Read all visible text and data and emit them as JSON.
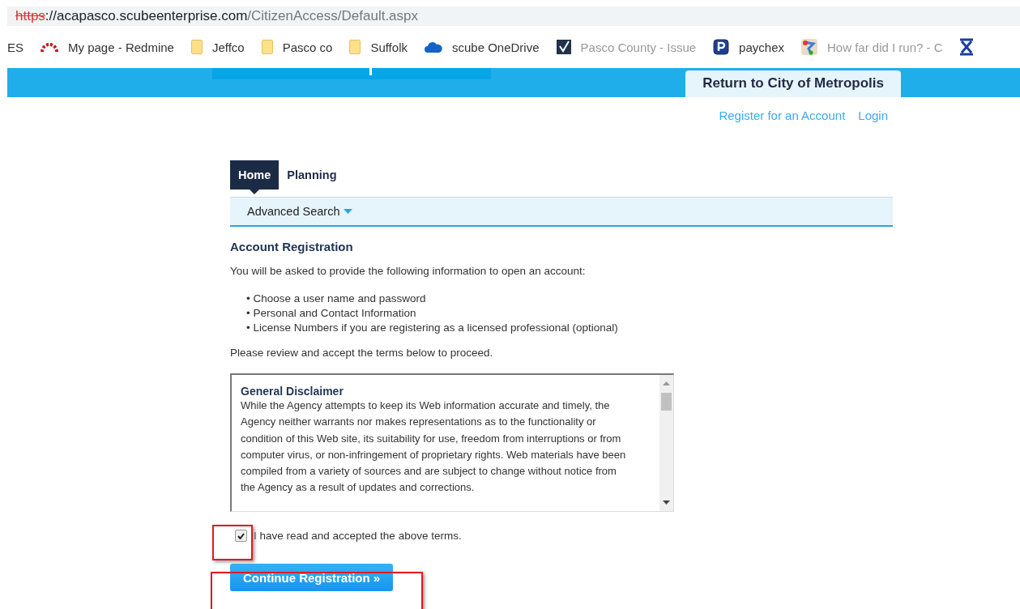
{
  "address_bar": {
    "scheme": "https",
    "host": "://acapasco.scubeenterprise.com",
    "path": "/CitizenAccess/Default.aspx",
    "scheme_insecure": true
  },
  "bookmarks": [
    {
      "kind": "none",
      "label": "ES"
    },
    {
      "kind": "arc",
      "label": "My page - Redmine"
    },
    {
      "kind": "folder",
      "label": "Jeffco"
    },
    {
      "kind": "folder",
      "label": "Pasco co"
    },
    {
      "kind": "folder",
      "label": "Suffolk"
    },
    {
      "kind": "cloud",
      "label": "scube OneDrive"
    },
    {
      "kind": "check",
      "label": "Pasco County - Issue"
    },
    {
      "kind": "parking",
      "label": "paychex"
    },
    {
      "kind": "map",
      "label": "How far did I run? - C"
    },
    {
      "kind": "logo"
    }
  ],
  "header": {
    "return_link": "Return to City of Metropolis"
  },
  "account_links": [
    "Register for an Account",
    "Login"
  ],
  "tabs": [
    {
      "label": "Home",
      "selected": true
    },
    {
      "label": "Planning",
      "selected": false
    }
  ],
  "subnav": {
    "label": "Advanced Search"
  },
  "registration": {
    "title": "Account Registration",
    "intro": "You will be asked to provide the following information to open an account:",
    "items": [
      "• Choose a user name and password",
      "• Personal and Contact Information",
      "• License Numbers if you are registering as a licensed professional (optional)"
    ],
    "review_note": "Please review and accept the terms below to proceed.",
    "terms": {
      "title": "General Disclaimer",
      "body": "While the Agency attempts to keep its Web information accurate and timely, the Agency neither warrants nor makes representations as to the functionality or condition of this Web site, its suitability for use, freedom from interruptions or from computer virus, or non-infringement of proprietary rights. Web materials have been compiled from a variety of sources and are subject to change without notice from the Agency as a result of updates and corrections."
    },
    "accept": {
      "label": "I have read and accepted the above terms.",
      "checked": true
    },
    "continue_button": "Continue Registration »"
  }
}
